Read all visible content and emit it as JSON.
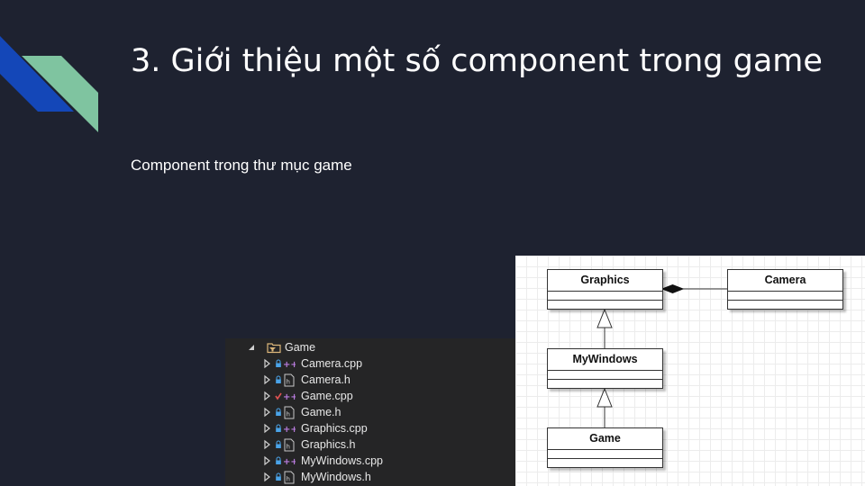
{
  "slide": {
    "title": "3. Giới thiệu một số component trong game",
    "subtitle": "Component trong thư mục game",
    "colors": {
      "background": "#1e2230",
      "accent_blue": "#1447b8",
      "accent_green": "#7fc4a0"
    }
  },
  "explorer": {
    "project": {
      "label": "Game",
      "icon": "folder-filter-icon",
      "expanded": true
    },
    "files": [
      {
        "label": "Camera.cpp",
        "type": "cpp",
        "status": "lock"
      },
      {
        "label": "Camera.h",
        "type": "h",
        "status": "lock"
      },
      {
        "label": "Game.cpp",
        "type": "cpp",
        "status": "check"
      },
      {
        "label": "Game.h",
        "type": "h",
        "status": "lock"
      },
      {
        "label": "Graphics.cpp",
        "type": "cpp",
        "status": "lock"
      },
      {
        "label": "Graphics.h",
        "type": "h",
        "status": "lock"
      },
      {
        "label": "MyWindows.cpp",
        "type": "cpp",
        "status": "lock"
      },
      {
        "label": "MyWindows.h",
        "type": "h",
        "status": "lock"
      }
    ]
  },
  "uml": {
    "classes": {
      "graphics": "Graphics",
      "camera": "Camera",
      "mywindows": "MyWindows",
      "game": "Game"
    },
    "relations": [
      {
        "from": "Camera",
        "to": "Graphics",
        "kind": "composition"
      },
      {
        "from": "MyWindows",
        "to": "Graphics",
        "kind": "inheritance"
      },
      {
        "from": "Game",
        "to": "MyWindows",
        "kind": "inheritance"
      }
    ]
  }
}
